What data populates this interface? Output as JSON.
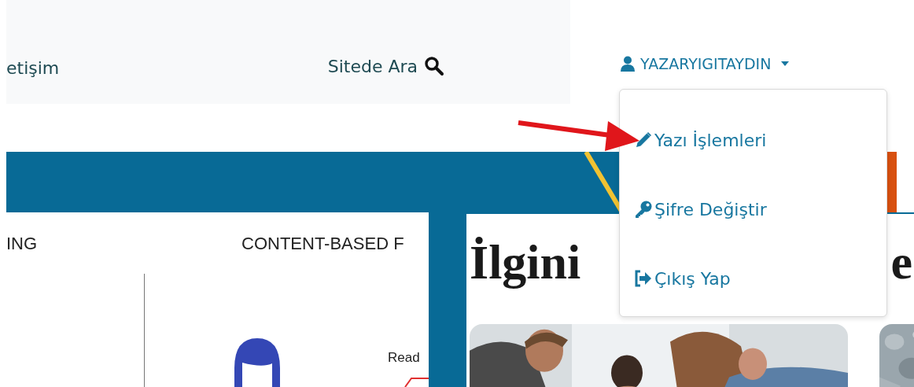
{
  "nav": {
    "links": [
      {
        "label": "etişim"
      }
    ],
    "search": {
      "label": "Sitede Ara"
    },
    "user": {
      "name": "YAZARYIGITAYDIN",
      "expanded": true
    }
  },
  "dropdown": {
    "items": [
      {
        "kind": "edit",
        "label": "Yazı İşlemleri"
      },
      {
        "kind": "password",
        "label": "Şifre Değiştir"
      },
      {
        "kind": "logout",
        "label": "Çıkış Yap"
      }
    ]
  },
  "diagram": {
    "labels": [
      "ING",
      "CONTENT-BASED F",
      "Read"
    ]
  },
  "modal": {
    "heading_parts": [
      "İlgini",
      "e"
    ],
    "cards": [
      {
        "kind": "picture"
      },
      {
        "kind": "picture"
      }
    ]
  }
}
